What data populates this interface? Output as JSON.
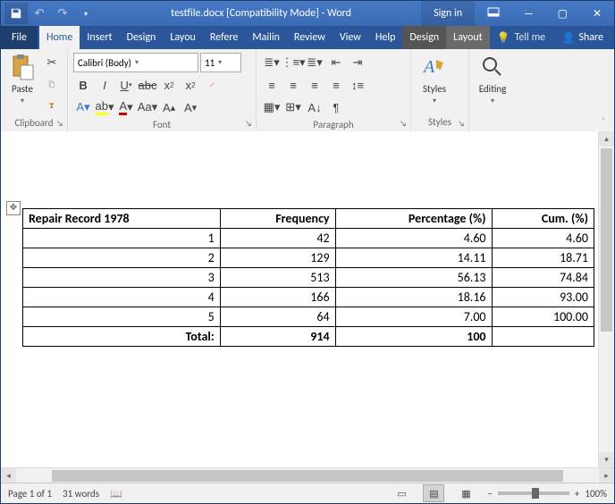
{
  "titlebar": {
    "title": "testfile.docx  [Compatibility Mode]  -  Word",
    "signin": "Sign in"
  },
  "tabs": {
    "file": "File",
    "items": [
      "Home",
      "Insert",
      "Design",
      "Layout",
      "References",
      "Mailings",
      "Review",
      "View",
      "Help"
    ],
    "visible": [
      "Home",
      "Insert",
      "Design",
      "Layou",
      "Refere",
      "Mailin",
      "Review",
      "View",
      "Help"
    ],
    "context": [
      "Design",
      "Layout"
    ],
    "tellme": "Tell me",
    "share": "Share"
  },
  "ribbon": {
    "clipboard": {
      "label": "Clipboard",
      "paste": "Paste"
    },
    "font": {
      "label": "Font",
      "family": "Calibri (Body)",
      "size": "11"
    },
    "paragraph": {
      "label": "Paragraph"
    },
    "styles": {
      "label": "Styles",
      "button": "Styles"
    },
    "editing": {
      "label": "Editing"
    }
  },
  "document": {
    "headers": [
      "Repair Record 1978",
      "Frequency",
      "Percentage (%)",
      "Cum. (%)"
    ],
    "rows": [
      [
        "1",
        "42",
        "4.60",
        "4.60"
      ],
      [
        "2",
        "129",
        "14.11",
        "18.71"
      ],
      [
        "3",
        "513",
        "56.13",
        "74.84"
      ],
      [
        "4",
        "166",
        "18.16",
        "93.00"
      ],
      [
        "5",
        "64",
        "7.00",
        "100.00"
      ]
    ],
    "total_label": "Total:",
    "total_freq": "914",
    "total_pct": "100"
  },
  "status": {
    "page": "Page 1 of 1",
    "words": "31 words",
    "zoom": "100%"
  },
  "chart_data": {
    "type": "table",
    "title": "Repair Record 1978 frequency distribution",
    "columns": [
      "Repair Record 1978",
      "Frequency",
      "Percentage (%)",
      "Cum. (%)"
    ],
    "rows": [
      [
        1,
        42,
        4.6,
        4.6
      ],
      [
        2,
        129,
        14.11,
        18.71
      ],
      [
        3,
        513,
        56.13,
        74.84
      ],
      [
        4,
        166,
        18.16,
        93.0
      ],
      [
        5,
        64,
        7.0,
        100.0
      ]
    ],
    "totals": {
      "Frequency": 914,
      "Percentage (%)": 100
    }
  }
}
